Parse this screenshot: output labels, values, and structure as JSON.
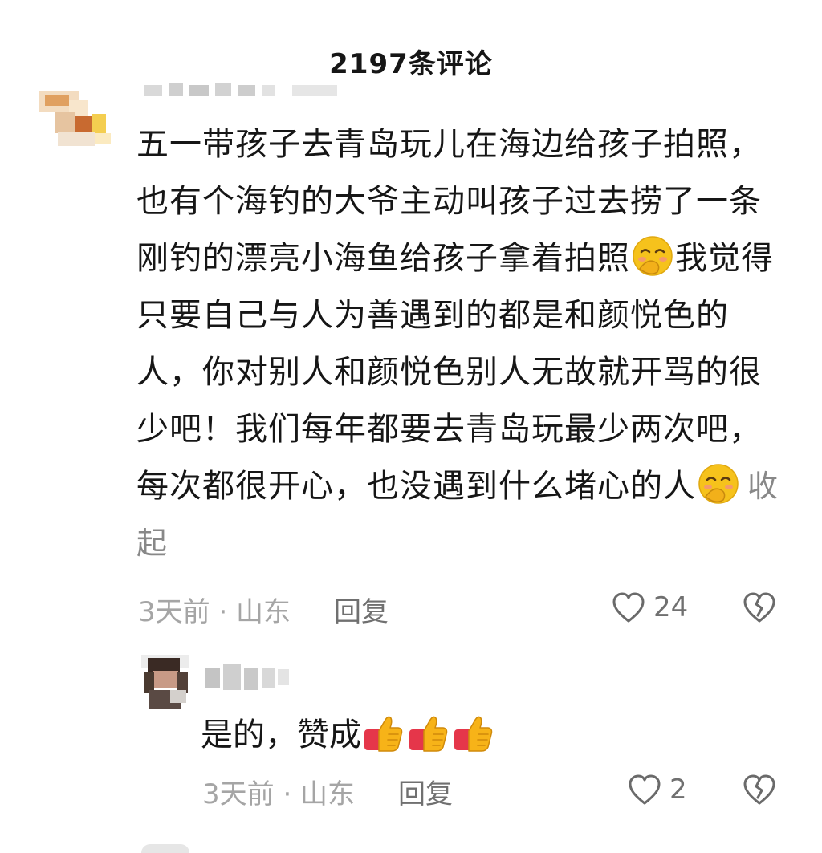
{
  "header": {
    "title": "2197条评论"
  },
  "comments": [
    {
      "text_part1": "五一带孩子去青岛玩儿在海边给孩子拍照，也有个海钓的大爷主动叫孩子过去捞了一条刚钓的漂亮小海鱼给孩子拿着拍照",
      "emoji_1": "shy-smile-emoji",
      "text_part2": "我觉得只要自己与人为善遇到的都是和颜悦色的人，你对别人和颜悦色别人无故就开骂的很少吧！我们每年都要去青岛玩最少两次吧，每次都很开心，也没遇到什么堵心的人",
      "emoji_2": "shy-smile-emoji",
      "collapse_label": "收起",
      "meta": "3天前 · 山东",
      "reply_label": "回复",
      "likes": "24"
    }
  ],
  "replies": [
    {
      "text": "是的，赞成",
      "emojis": [
        "thumbs-up-emoji",
        "thumbs-up-emoji",
        "thumbs-up-emoji"
      ],
      "meta": "3天前 · 山东",
      "reply_label": "回复",
      "likes": "2"
    }
  ],
  "colors": {
    "text": "#161616",
    "meta": "#a5a5a5",
    "action": "#707070",
    "emoji_face": "#f6c21c",
    "thumb_red": "#e5364a"
  }
}
